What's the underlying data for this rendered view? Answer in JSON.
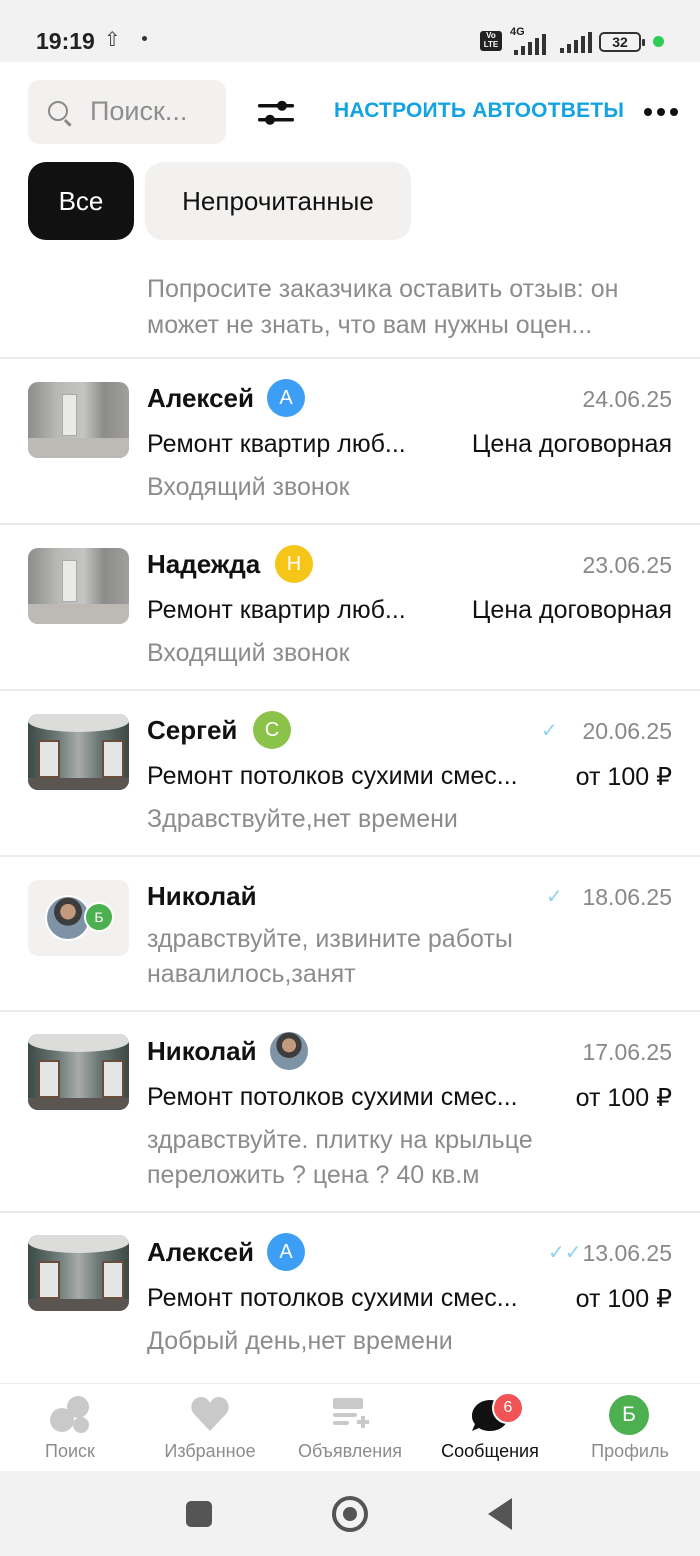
{
  "status_bar": {
    "time": "19:19",
    "battery": "32",
    "network": "4G"
  },
  "toolbar": {
    "search_placeholder": "Поиск...",
    "autoreply_label": "НАСТРОИТЬ АВТООТВЕТЫ"
  },
  "filters": {
    "all": "Все",
    "unread": "Непрочитанные"
  },
  "banner": {
    "text": "Попросите заказчика оставить отзыв: он может не знать, что вам нужны оцен..."
  },
  "colors": {
    "accent": "#13a3e0",
    "badge_blue": "#3c9ef5",
    "badge_yellow": "#f5c518",
    "badge_green": "#8bc34a",
    "badge_green2": "#4caf50",
    "notify": "#f05454"
  },
  "chats": [
    {
      "name": "Алексей",
      "initial": "А",
      "date": "24.06.25",
      "title": "Ремонт квартир люб...",
      "price": "Цена договорная",
      "last": "Входящий звонок"
    },
    {
      "name": "Надежда",
      "initial": "Н",
      "date": "23.06.25",
      "title": "Ремонт квартир люб...",
      "price": "Цена договорная",
      "last": "Входящий звонок"
    },
    {
      "name": "Сергей",
      "initial": "С",
      "date": "20.06.25",
      "title": "Ремонт потолков сухими смес...",
      "price": "от 100 ₽",
      "last": "Здравствуйте,нет времени"
    },
    {
      "name": "Николай",
      "initial": "Б",
      "date": "18.06.25",
      "title": "",
      "price": "",
      "last": "здравствуйте, извините работы навалилось,занят"
    },
    {
      "name": "Николай",
      "initial": "",
      "date": "17.06.25",
      "title": "Ремонт потолков сухими смес...",
      "price": "от 100 ₽",
      "last": "здравствуйте.  плитку на крыльце переложить ? цена ? 40 кв.м"
    },
    {
      "name": "Алексей",
      "initial": "А",
      "date": "13.06.25",
      "title": "Ремонт потолков сухими смес...",
      "price": "от 100 ₽",
      "last": "Добрый день,нет времени"
    }
  ],
  "tabs": [
    {
      "label": "Поиск",
      "icon": "search-bubbles-icon"
    },
    {
      "label": "Избранное",
      "icon": "heart-icon"
    },
    {
      "label": "Объявления",
      "icon": "ads-list-icon"
    },
    {
      "label": "Сообщения",
      "icon": "chat-icon",
      "badge": "6"
    },
    {
      "label": "Профиль",
      "icon": "profile-avatar-icon",
      "initial": "Б"
    }
  ]
}
